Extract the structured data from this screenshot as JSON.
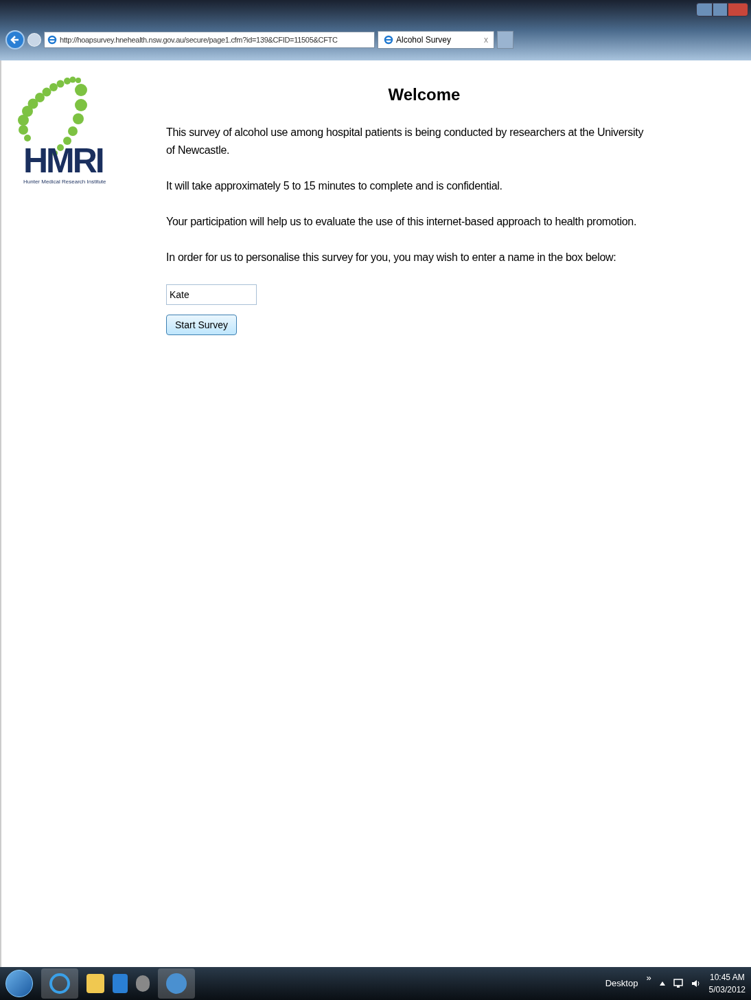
{
  "browser": {
    "url": "http://hoapsurvey.hnehealth.nsw.gov.au/secure/page1.cfm?id=139&CFID=11505&CFTC",
    "tabs": [
      {
        "label": "Alcohol Survey",
        "close": "x",
        "selected": true
      }
    ]
  },
  "logo": {
    "mark": "HMRI",
    "subtitle": "Hunter Medical Research Institute"
  },
  "page": {
    "heading": "Welcome",
    "paragraphs": [
      "This survey of alcohol use among hospital patients is being conducted by researchers at the University of Newcastle.",
      "It will take approximately 5 to 15 minutes to complete and is confidential.",
      "Your participation will help us to evaluate the use of this internet-based approach to health promotion.",
      "In order for us to personalise this survey for you, you may wish to enter a name in the box below:"
    ],
    "name_field": {
      "value": "Kate"
    },
    "button": "Start Survey"
  },
  "taskbar": {
    "desktop": "Desktop",
    "chevron": "»",
    "time": "10:45 AM",
    "date": "5/03/2012"
  }
}
